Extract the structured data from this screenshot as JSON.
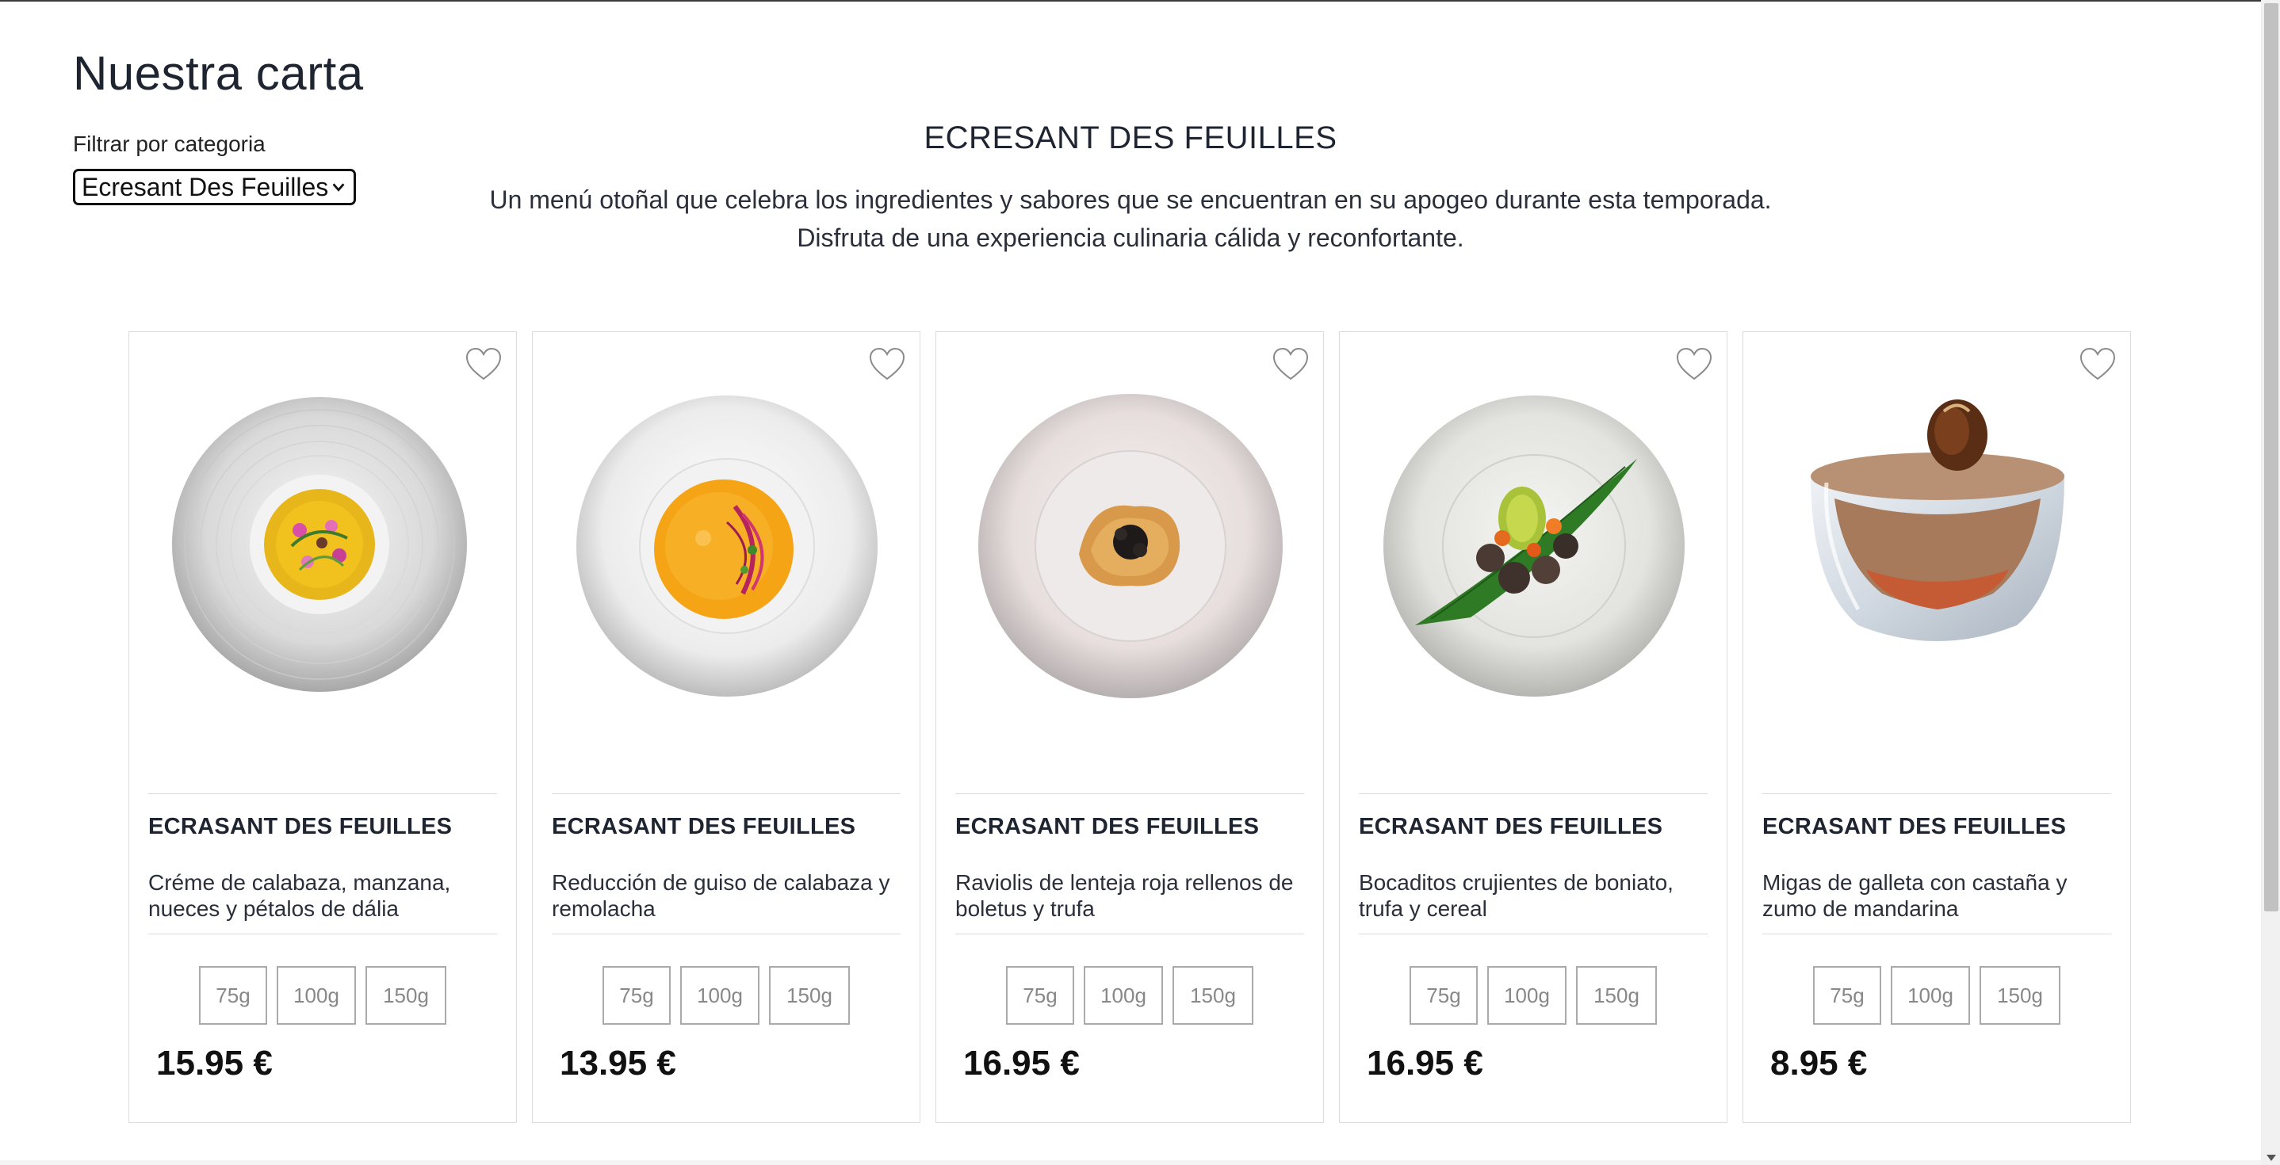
{
  "page": {
    "title": "Nuestra carta"
  },
  "filter": {
    "label": "Filtrar por categoria",
    "selected": "Ecresant Des Feuilles"
  },
  "menu": {
    "heading": "ECRESANT DES FEUILLES",
    "description_line1": "Un menú otoñal que celebra los ingredientes y sabores que se encuentran en su apogeo durante esta temporada.",
    "description_line2": "Disfruta de una experiencia culinaria cálida y reconfortante."
  },
  "dishes": [
    {
      "name": "ECRASANT DES FEUILLES",
      "description": "Créme de calabaza, manzana, nueces y pétalos de dália",
      "sizes": [
        "75g",
        "100g",
        "150g"
      ],
      "price": "15.95 €",
      "icon": "heart-outline-icon"
    },
    {
      "name": "ECRASANT DES FEUILLES",
      "description": "Reducción de guiso de calabaza y remolacha",
      "sizes": [
        "75g",
        "100g",
        "150g"
      ],
      "price": "13.95 €",
      "icon": "heart-outline-icon"
    },
    {
      "name": "ECRASANT DES FEUILLES",
      "description": "Raviolis de lenteja roja rellenos de boletus y trufa",
      "sizes": [
        "75g",
        "100g",
        "150g"
      ],
      "price": "16.95 €",
      "icon": "heart-outline-icon"
    },
    {
      "name": "ECRASANT DES FEUILLES",
      "description": "Bocaditos crujientes de boniato, trufa y cereal",
      "sizes": [
        "75g",
        "100g",
        "150g"
      ],
      "price": "16.95 €",
      "icon": "heart-outline-icon"
    },
    {
      "name": "ECRASANT DES FEUILLES",
      "description": "Migas de galleta con castaña y zumo de mandarina",
      "sizes": [
        "75g",
        "100g",
        "150g"
      ],
      "price": "8.95 €",
      "icon": "heart-outline-icon"
    }
  ]
}
